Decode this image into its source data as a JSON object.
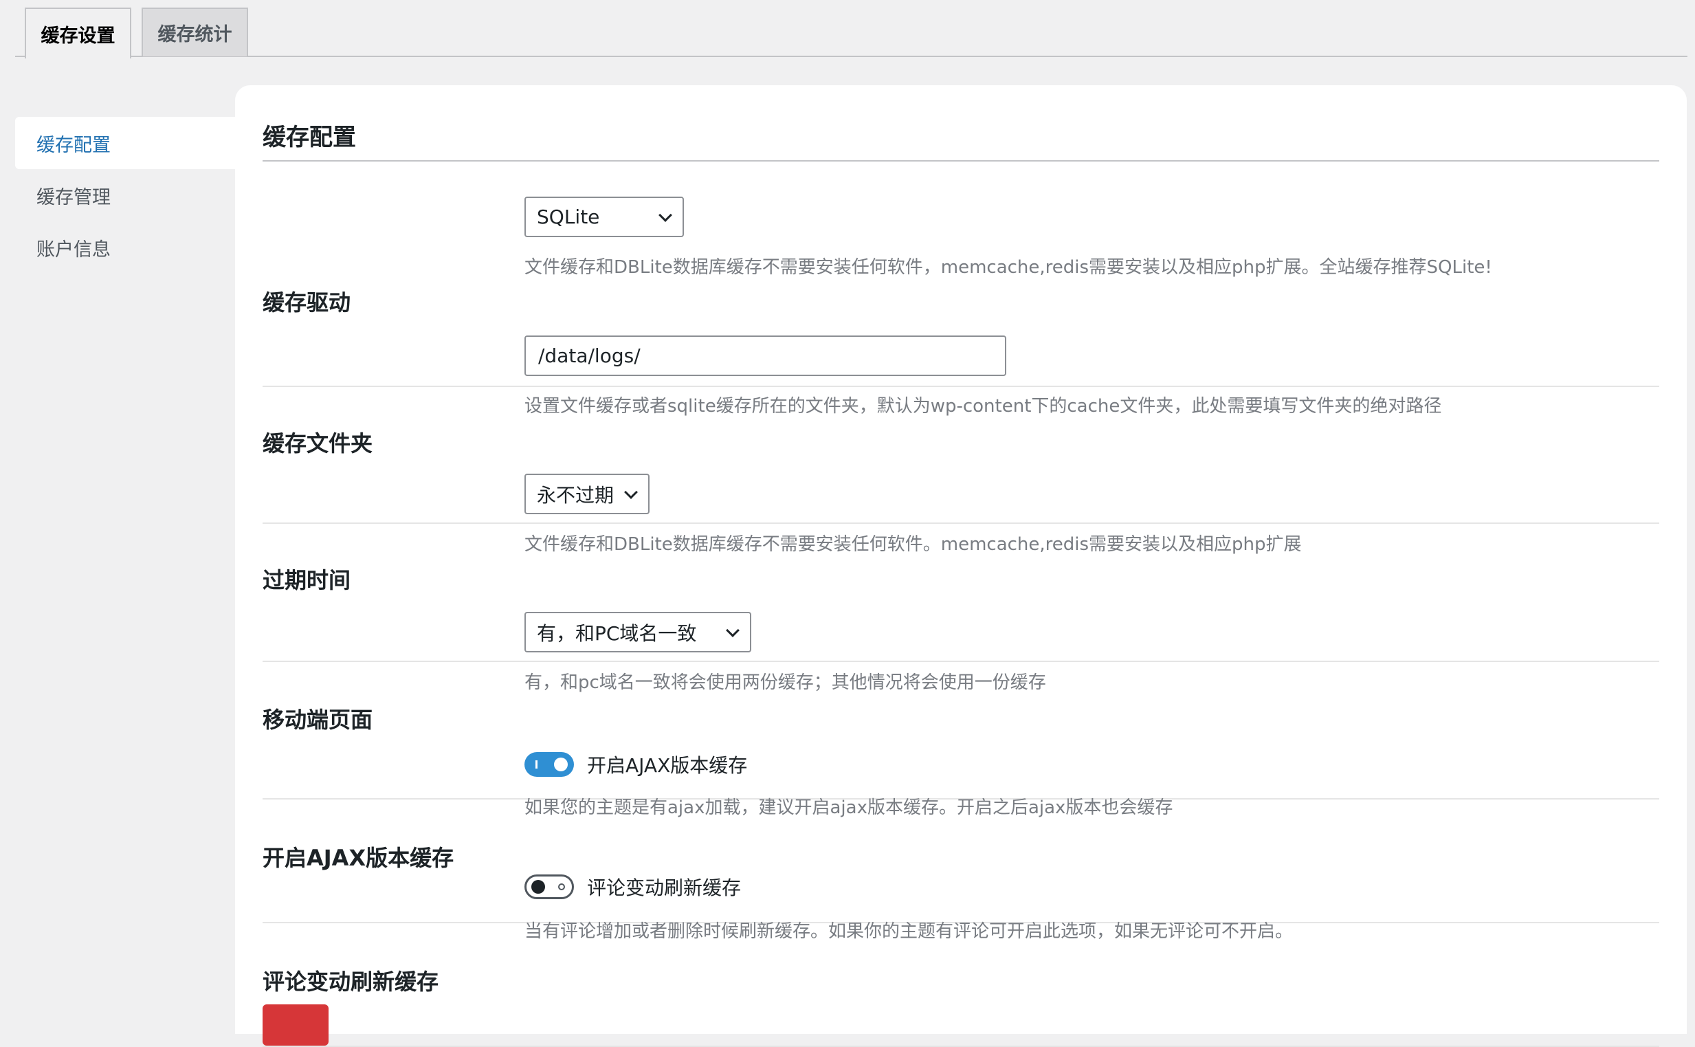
{
  "tabs": [
    {
      "label": "缓存设置",
      "active": true
    },
    {
      "label": "缓存统计",
      "active": false
    }
  ],
  "sidebar": {
    "items": [
      {
        "label": "缓存配置",
        "active": true
      },
      {
        "label": "缓存管理",
        "active": false
      },
      {
        "label": "账户信息",
        "active": false
      }
    ]
  },
  "panel": {
    "title": "缓存配置",
    "rows": {
      "driver": {
        "label": "缓存驱动",
        "value": "SQLite",
        "desc": "文件缓存和DBLite数据库缓存不需要安装任何软件，memcache,redis需要安装以及相应php扩展。全站缓存推荐SQLite!"
      },
      "folder": {
        "label": "缓存文件夹",
        "value": "/data/logs/",
        "desc": "设置文件缓存或者sqlite缓存所在的文件夹，默认为wp-content下的cache文件夹，此处需要填写文件夹的绝对路径"
      },
      "expire": {
        "label": "过期时间",
        "value": "永不过期",
        "desc": "文件缓存和DBLite数据库缓存不需要安装任何软件。memcache,redis需要安装以及相应php扩展"
      },
      "mobile": {
        "label": "移动端页面",
        "value": "有，和PC域名一致",
        "desc": "有，和pc域名一致将会使用两份缓存；其他情况将会使用一份缓存"
      },
      "ajax": {
        "label": "开启AJAX版本缓存",
        "toggle_label": "开启AJAX版本缓存",
        "enabled": true,
        "desc": "如果您的主题是有ajax加载，建议开启ajax版本缓存。开启之后ajax版本也会缓存"
      },
      "comment": {
        "label": "评论变动刷新缓存",
        "toggle_label": "评论变动刷新缓存",
        "enabled": false,
        "desc": "当有评论增加或者删除时候刷新缓存。如果你的主题有评论可开启此选项，如果无评论可不开启。"
      }
    }
  },
  "colors": {
    "accent": "#2271b1",
    "toggle_on": "#2f8fd3",
    "save_button": "#d63638"
  }
}
